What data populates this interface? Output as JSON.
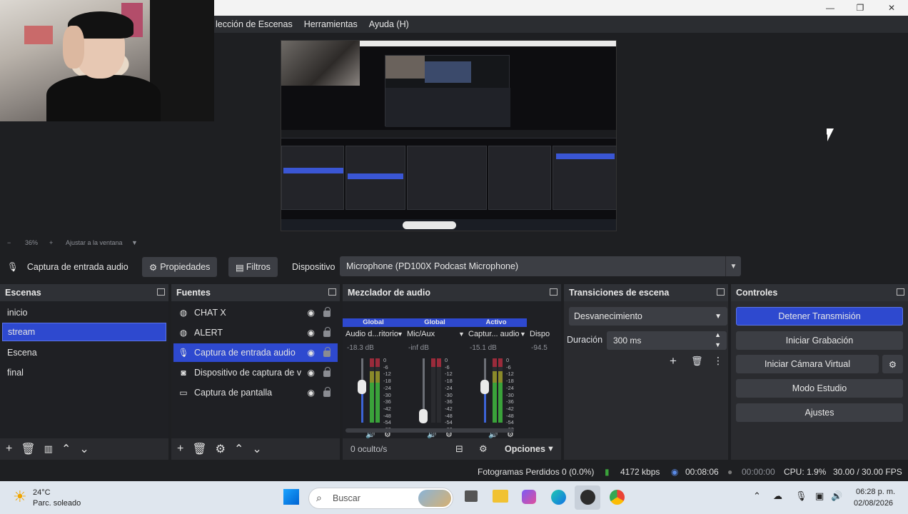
{
  "menu": {
    "items": [
      "lección de Escenas",
      "Herramientas",
      "Ayuda (H)"
    ]
  },
  "window_controls": {
    "minimize": "—",
    "maximize": "❐",
    "close": "✕"
  },
  "zoom_bar": {
    "minus": "−",
    "zoom": "36%",
    "plus": "+",
    "fit_label": "Ajustar a la ventana",
    "fit_arrow": "▼"
  },
  "context_bar": {
    "source_name": "Captura de entrada audio",
    "properties_label": "Propiedades",
    "filters_label": "Filtros",
    "device_label": "Dispositivo",
    "device_value": "Microphone (PD100X Podcast Microphone)"
  },
  "scenes": {
    "title": "Escenas",
    "items": [
      "inicio",
      "stream",
      "Escena",
      "final"
    ],
    "selected": "stream"
  },
  "sources": {
    "title": "Fuentes",
    "items": [
      {
        "name": "CHAT X",
        "icon": "globe-icon"
      },
      {
        "name": "ALERT",
        "icon": "globe-icon"
      },
      {
        "name": "Captura de entrada audio",
        "icon": "microphone-icon"
      },
      {
        "name": "Dispositivo de captura de v",
        "icon": "camera-icon"
      },
      {
        "name": "Captura de pantalla",
        "icon": "monitor-icon"
      }
    ],
    "selected": "Captura de entrada audio"
  },
  "mixer": {
    "title": "Mezclador de audio",
    "channels": [
      {
        "tag": "Global",
        "name": "Audio d...ritorio",
        "db": "-18.3 dB",
        "level": 0.55
      },
      {
        "tag": "Global",
        "name": "Mic/Aux",
        "db": "-inf dB",
        "level": 0.1
      },
      {
        "tag": "Activo",
        "name": "Captur... audio",
        "db": "-15.1 dB",
        "level": 0.55
      },
      {
        "tag": "",
        "name": "Dispo",
        "db": "-94.5",
        "level": 0.0
      }
    ],
    "scale": [
      "0",
      "-6",
      "-12",
      "-18",
      "-24",
      "-30",
      "-36",
      "-42",
      "-48",
      "-54",
      "-60"
    ],
    "hidden_label": "0 oculto/s",
    "options_label": "Opciones"
  },
  "transitions": {
    "title": "Transiciones de escena",
    "selected": "Desvanecimiento",
    "duration_label": "Duración",
    "duration_value": "300 ms"
  },
  "controls": {
    "title": "Controles",
    "stop_stream": "Detener Transmisión",
    "start_recording": "Iniciar Grabación",
    "start_virtual_cam": "Iniciar Cámara Virtual",
    "studio_mode": "Modo Estudio",
    "settings": "Ajustes"
  },
  "status": {
    "dropped_frames": "Fotogramas Perdidos 0 (0.0%)",
    "bitrate": "4172 kbps",
    "stream_time": "00:08:06",
    "rec_time": "00:00:00",
    "cpu": "CPU: 1.9%",
    "fps": "30.00 / 30.00 FPS"
  },
  "taskbar": {
    "weather_temp": "24°C",
    "weather_desc": "Parc. soleado",
    "search_placeholder": "Buscar",
    "time": "06:28 p. m.",
    "date": "02/08/2026"
  },
  "colors": {
    "accent": "#2e49cf",
    "panel": "#2a2b2f",
    "background": "#1e1f22"
  }
}
